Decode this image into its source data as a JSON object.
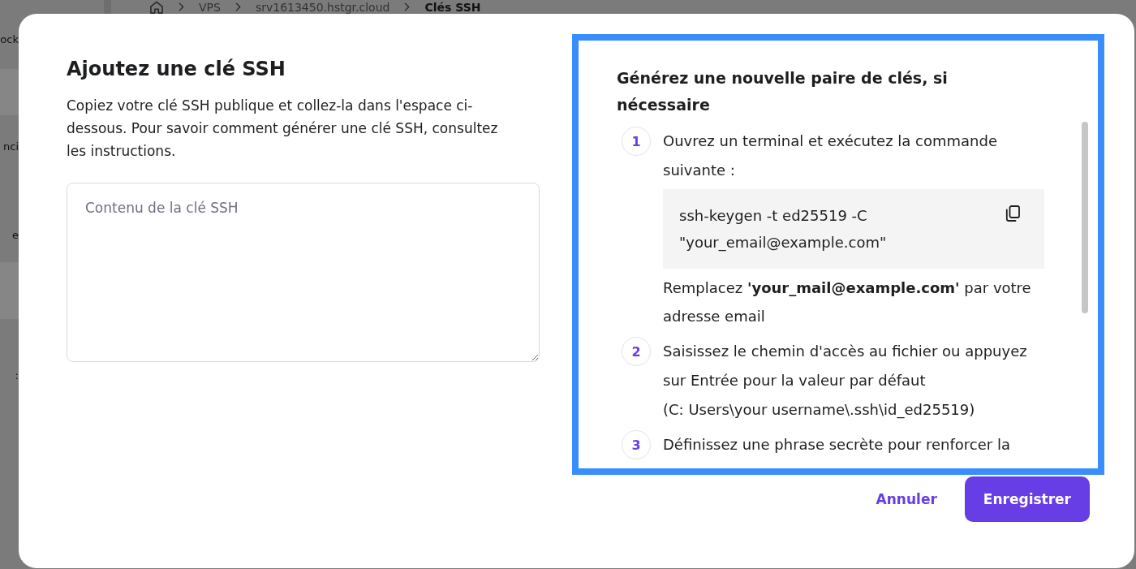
{
  "background": {
    "sidebar": [
      {
        "label": "ock",
        "highlighted": false
      },
      {
        "highlighted": true
      },
      {
        "label": "nci",
        "highlighted": false
      },
      {
        "label": "e",
        "highlighted": false
      },
      {
        "highlighted": true
      },
      {
        "label": ":",
        "highlighted": false
      }
    ],
    "breadcrumb": [
      {
        "label": "VPS",
        "current": false
      },
      {
        "label": "srv1613450.hstgr.cloud",
        "current": false
      },
      {
        "label": "Clés SSH",
        "current": true
      }
    ]
  },
  "dialog": {
    "title": "Ajoutez une clé SSH",
    "description": "Copiez votre clé SSH publique et collez-la dans l'espace ci-dessous. Pour savoir comment générer une clé SSH, consultez les instructions.",
    "key_field": {
      "placeholder": "Contenu de la clé SSH"
    },
    "instructions": {
      "title": "Générez une nouvelle paire de clés, si nécessaire",
      "steps": [
        {
          "number": "1",
          "text": "Ouvrez un terminal et exécutez la commande suivante :",
          "command": "ssh-keygen -t ed25519 -C \"your_email@example.com\"",
          "note": "Remplacez **'your_mail@example.com'** par votre adresse email"
        },
        {
          "number": "2",
          "text": "Saisissez le chemin d'accès au fichier ou appuyez sur Entrée pour la valeur par défaut",
          "note": "(C: Users\\your username\\.ssh\\id_ed25519)"
        },
        {
          "number": "3",
          "text": "Définissez une phrase secrète pour renforcer la"
        }
      ]
    },
    "buttons": [
      {
        "label": "Annuler",
        "kind": "link"
      },
      {
        "label": "Enregistrer",
        "kind": "primary"
      }
    ]
  }
}
